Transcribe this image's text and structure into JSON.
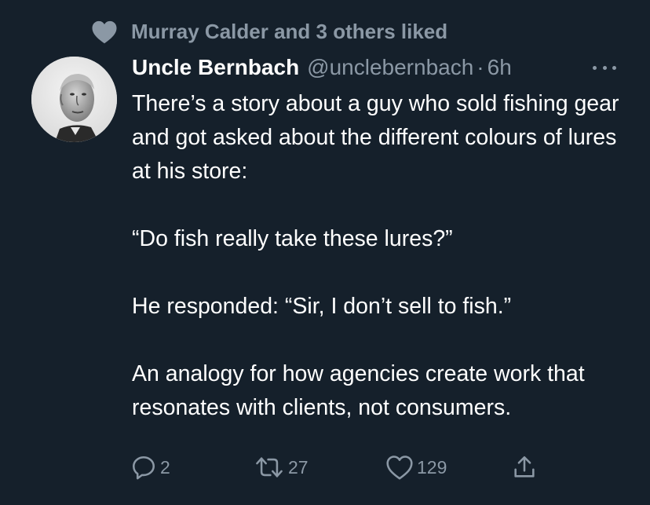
{
  "social_context": {
    "text": "Murray Calder and 3 others liked",
    "icon": "heart-icon"
  },
  "author": {
    "name": "Uncle Bernbach",
    "handle": "@unclebernbach",
    "separator": "·",
    "time": "6h",
    "avatar_icon": "avatar-photo"
  },
  "tweet": {
    "paragraphs": [
      "There’s a story about a guy who sold fishing gear and got asked about the different colours of lures at his store:",
      "“Do fish really take these lures?”",
      "He responded: “Sir, I don’t sell to fish.”",
      "An analogy for how agencies create work that resonates with clients, not consumers."
    ]
  },
  "actions": {
    "reply_count": "2",
    "retweet_count": "27",
    "like_count": "129"
  },
  "colors": {
    "background": "#15202b",
    "text_primary": "#ffffff",
    "text_secondary": "#8b98a5"
  }
}
